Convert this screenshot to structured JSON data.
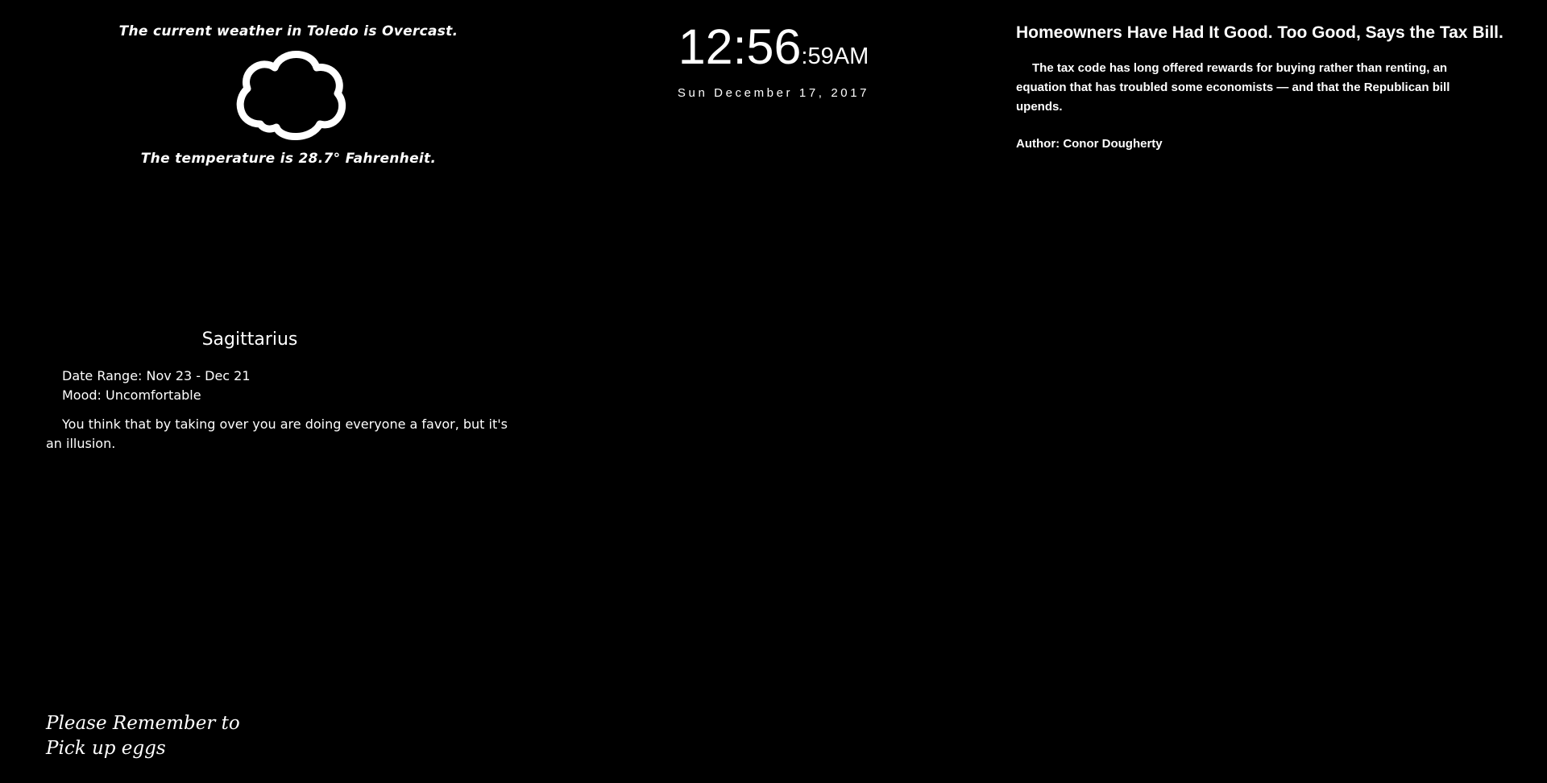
{
  "weather": {
    "condition_line": "The current weather in Toledo is Overcast.",
    "icon": "cloud-outline-icon",
    "temperature_line": "The temperature is 28.7° Fahrenheit."
  },
  "clock": {
    "hours_minutes": "12:56",
    "seconds_ampm": ":59AM",
    "date": "Sun December 17, 2017"
  },
  "news": {
    "headline": "Homeowners Have Had It Good. Too Good, Says the Tax Bill.",
    "summary": "The tax code has long offered rewards for buying rather than renting, an equation that has troubled some economists — and that the Republican bill upends.",
    "author": "Author: Conor Dougherty"
  },
  "horoscope": {
    "sign": "Sagittarius",
    "date_range": "Date Range: Nov 23 - Dec 21",
    "mood": "Mood: Uncomfortable",
    "description": "You think that by taking over you are doing everyone a favor, but it's an illusion."
  },
  "reminder": {
    "line1": "Please Remember to",
    "line2": "Pick up eggs"
  },
  "colors": {
    "background": "#000000",
    "text": "#ffffff"
  }
}
